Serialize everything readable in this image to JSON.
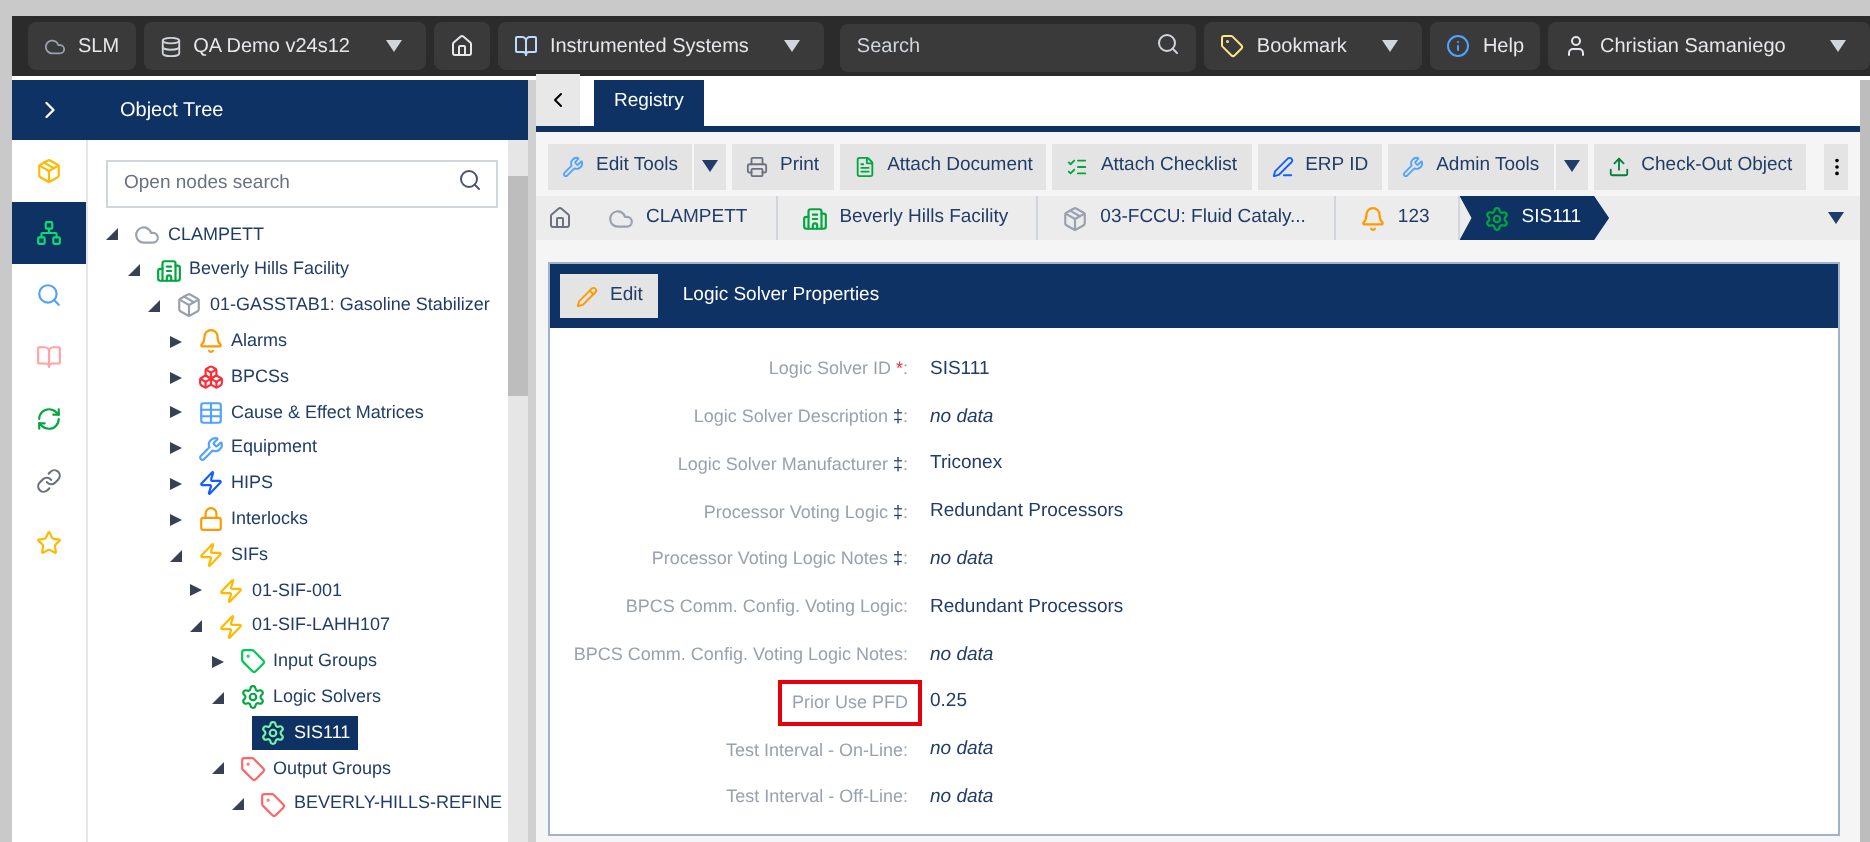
{
  "top_bar": {
    "app": "SLM",
    "database": "QA Demo v24s12",
    "module": "Instrumented Systems",
    "search": {
      "placeholder": "Search"
    },
    "bookmark": "Bookmark",
    "help": "Help",
    "user": "Christian Samaniego"
  },
  "side_icons": [
    {
      "kind": "cube",
      "selected": false
    },
    {
      "kind": "tree",
      "selected": true
    },
    {
      "kind": "search",
      "selected": false
    },
    {
      "kind": "book",
      "selected": false
    },
    {
      "kind": "refresh",
      "selected": false
    },
    {
      "kind": "link",
      "selected": false
    },
    {
      "kind": "star",
      "selected": false
    }
  ],
  "object_tree": {
    "title": "Object Tree",
    "search": {
      "placeholder": "Open nodes search"
    },
    "items": [
      {
        "label": "CLAMPETT",
        "kind": "site",
        "expanded": true,
        "selected": false,
        "children": [
          {
            "label": "Beverly Hills Facility",
            "kind": "facility",
            "expanded": true,
            "selected": false,
            "children": [
              {
                "label": "01-GASSTAB1: Gasoline Stabilizer",
                "kind": "unit",
                "expanded": true,
                "selected": false,
                "children": [
                  {
                    "label": "Alarms",
                    "kind": "alarm",
                    "expanded": false,
                    "selected": false
                  },
                  {
                    "label": "BPCSs",
                    "kind": "bpcs",
                    "expanded": false,
                    "selected": false
                  },
                  {
                    "label": "Cause & Effect Matrices",
                    "kind": "matrix",
                    "expanded": false,
                    "selected": false
                  },
                  {
                    "label": "Equipment",
                    "kind": "equipment",
                    "expanded": false,
                    "selected": false
                  },
                  {
                    "label": "HIPS",
                    "kind": "hips",
                    "expanded": false,
                    "selected": false
                  },
                  {
                    "label": "Interlocks",
                    "kind": "interlock",
                    "expanded": false,
                    "selected": false
                  },
                  {
                    "label": "SIFs",
                    "kind": "sif",
                    "expanded": true,
                    "selected": false,
                    "children": [
                      {
                        "label": "01-SIF-001",
                        "kind": "sif",
                        "expanded": false,
                        "selected": false
                      },
                      {
                        "label": "01-SIF-LAHH107",
                        "kind": "sif",
                        "expanded": true,
                        "selected": false,
                        "children": [
                          {
                            "label": "Input Groups",
                            "kind": "group",
                            "expanded": false,
                            "selected": false
                          },
                          {
                            "label": "Logic Solvers",
                            "kind": "solver",
                            "expanded": true,
                            "selected": false,
                            "children": [
                              {
                                "label": "SIS111",
                                "kind": "solver",
                                "selected": true
                              }
                            ]
                          },
                          {
                            "label": "Output Groups",
                            "kind": "tag",
                            "expanded": true,
                            "selected": false,
                            "children": [
                              {
                                "label": "BEVERLY-HILLS-REFINE",
                                "kind": "tag",
                                "expanded": true,
                                "selected": false
                              }
                            ]
                          }
                        ]
                      }
                    ]
                  }
                ]
              }
            ]
          }
        ]
      }
    ]
  },
  "tabs": [
    {
      "label": "Registry",
      "selected": true
    }
  ],
  "toolbar": [
    {
      "label": "Edit Tools",
      "kind": "wrench",
      "dropdown": true
    },
    {
      "label": "Print",
      "kind": "printer",
      "dropdown": false
    },
    {
      "label": "Attach Document",
      "kind": "document",
      "dropdown": false
    },
    {
      "label": "Attach Checklist",
      "kind": "checklist",
      "dropdown": false
    },
    {
      "label": "ERP ID",
      "kind": "pen",
      "dropdown": false
    },
    {
      "label": "Admin Tools",
      "kind": "wrench",
      "dropdown": true
    },
    {
      "label": "Check-Out Object",
      "kind": "checkout",
      "dropdown": false
    }
  ],
  "breadcrumb": [
    {
      "label": "CLAMPETT",
      "kind": "site",
      "selected": false
    },
    {
      "label": "Beverly Hills Facility",
      "kind": "facility",
      "selected": false
    },
    {
      "label": "03-FCCU: Fluid Cataly...",
      "kind": "unit",
      "selected": false
    },
    {
      "label": "123",
      "kind": "alarm",
      "selected": false
    },
    {
      "label": "SIS111",
      "kind": "solver",
      "selected": true
    }
  ],
  "panel": {
    "edit_button": "Edit",
    "title": "Logic Solver Properties",
    "fields": [
      {
        "label": "Logic Solver ID",
        "marker": "*",
        "required": true,
        "end": ":",
        "value": "SIS111",
        "empty": false,
        "highlighted": false
      },
      {
        "label": "Logic Solver Description",
        "marker": "‡",
        "required": false,
        "end": ":",
        "value": "no data",
        "empty": true,
        "highlighted": false
      },
      {
        "label": "Logic Solver Manufacturer",
        "marker": "‡",
        "required": false,
        "end": ":",
        "value": "Triconex",
        "empty": false,
        "highlighted": false
      },
      {
        "label": "Processor Voting Logic",
        "marker": "‡",
        "required": false,
        "end": ":",
        "value": "Redundant Processors",
        "empty": false,
        "highlighted": false
      },
      {
        "label": "Processor Voting Logic Notes",
        "marker": "‡",
        "required": false,
        "end": ":",
        "value": "no data",
        "empty": true,
        "highlighted": false
      },
      {
        "label": "BPCS Comm. Config. Voting Logic:",
        "value": "Redundant Processors",
        "empty": false,
        "highlighted": false
      },
      {
        "label": "BPCS Comm. Config. Voting Logic Notes:",
        "value": "no data",
        "empty": true,
        "highlighted": false
      },
      {
        "label": "Prior Use PFD",
        "value": "0.25",
        "empty": false,
        "highlighted": true
      },
      {
        "label": "Test Interval - On-Line:",
        "value": "no data",
        "empty": true,
        "highlighted": false
      },
      {
        "label": "Test Interval - Off-Line:",
        "value": "no data",
        "empty": true,
        "highlighted": false
      }
    ]
  }
}
